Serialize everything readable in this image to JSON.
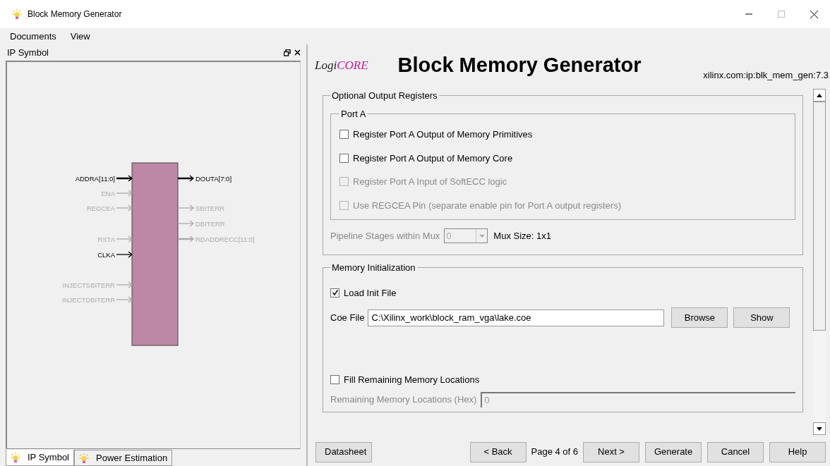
{
  "window": {
    "title": "Block Memory Generator"
  },
  "menu": [
    {
      "label": "Documents"
    },
    {
      "label": "View"
    }
  ],
  "left_panel": {
    "title": "IP Symbol",
    "input_pins": [
      {
        "name": "ADDRA[11:0]",
        "active": true,
        "bus": true
      },
      {
        "name": "ENA",
        "active": false,
        "bus": false
      },
      {
        "name": "REGCEA",
        "active": false,
        "bus": false
      },
      {
        "name": "RSTA",
        "active": false,
        "bus": false
      },
      {
        "name": "CLKA",
        "active": true,
        "bus": false
      },
      {
        "name": "INJECTSBITERR",
        "active": false,
        "bus": false
      },
      {
        "name": "INJECTDBITERR",
        "active": false,
        "bus": false
      }
    ],
    "output_pins": [
      {
        "name": "DOUTA[7:0]",
        "active": true,
        "bus": true
      },
      {
        "name": "SBITERR",
        "active": false,
        "bus": false
      },
      {
        "name": "DBITERR",
        "active": false,
        "bus": false
      },
      {
        "name": "RDADDRECC[11:0]",
        "active": false,
        "bus": true
      }
    ],
    "tabs": [
      {
        "label": "IP Symbol",
        "selected": true
      },
      {
        "label": "Power Estimation",
        "selected": false
      }
    ]
  },
  "header": {
    "logo_plain": "Logi",
    "logo_accent": "CORE",
    "title": "Block Memory Generator",
    "ip_id": "xilinx.com:ip:blk_mem_gen:7.3"
  },
  "output_registers": {
    "title": "Optional Output Registers",
    "port": {
      "title": "Port A",
      "options": [
        {
          "label": "Register Port A Output of Memory Primitives",
          "checked": false,
          "disabled": false
        },
        {
          "label": "Register Port A Output of Memory Core",
          "checked": false,
          "disabled": false
        },
        {
          "label": "Register Port A Input of SoftECC logic",
          "checked": false,
          "disabled": true
        },
        {
          "label": "Use REGCEA Pin (separate enable pin for Port A output registers)",
          "checked": false,
          "disabled": true
        }
      ]
    },
    "pipeline": {
      "label": "Pipeline Stages within Mux",
      "value": "0",
      "disabled": true
    },
    "mux_size": "Mux Size: 1x1"
  },
  "memory_init": {
    "title": "Memory Initialization",
    "load_init": {
      "label": "Load Init File",
      "checked": true
    },
    "coe_file": {
      "label": "Coe File",
      "value": "C:\\Xilinx_work\\block_ram_vga\\lake.coe"
    },
    "buttons": [
      {
        "label": "Browse"
      },
      {
        "label": "Show"
      }
    ],
    "fill": {
      "label": "Fill Remaining Memory Locations",
      "checked": false
    },
    "remaining": {
      "label": "Remaining Memory Locations (Hex)",
      "value": "0",
      "disabled": true
    }
  },
  "footer": {
    "datasheet": "Datasheet",
    "back": "< Back",
    "page": "Page 4 of 6",
    "next": "Next >",
    "generate": "Generate",
    "cancel": "Cancel",
    "help": "Help"
  }
}
